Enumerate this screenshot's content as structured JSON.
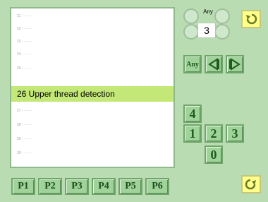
{
  "list": {
    "rows": [
      "21 - - - - -",
      "22 - - - - -",
      "23 - - - - -",
      "24 - - - - -",
      "25 - - - - -"
    ],
    "selected": "26 Upper thread detection",
    "rows_after": [
      "27 - - - - -",
      "28 - - - - -",
      "29 - - - - -",
      "30 - - - - -"
    ]
  },
  "selector": {
    "any_label": "Any",
    "value": "3"
  },
  "nav": {
    "any_label": "Any"
  },
  "keypad": {
    "k4": "4",
    "k1": "1",
    "k2": "2",
    "k3": "3",
    "k0": "0"
  },
  "pages": [
    "P1",
    "P2",
    "P3",
    "P4",
    "P5",
    "P6"
  ],
  "colors": {
    "background": "#b9dcb3",
    "selected_row": "#c4e878",
    "button": "#9fd39a",
    "yellow_button": "#ffff8a"
  }
}
